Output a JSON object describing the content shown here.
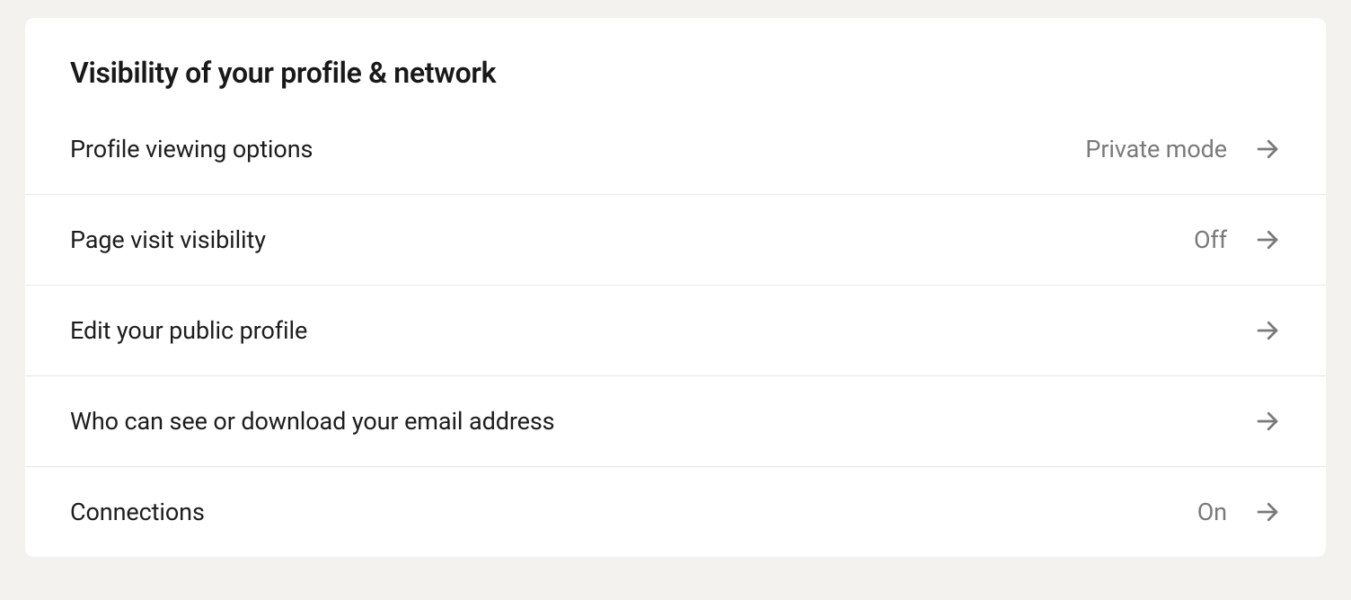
{
  "section": {
    "title": "Visibility of your profile & network"
  },
  "settings": [
    {
      "label": "Profile viewing options",
      "value": "Private mode"
    },
    {
      "label": "Page visit visibility",
      "value": "Off"
    },
    {
      "label": "Edit your public profile",
      "value": ""
    },
    {
      "label": "Who can see or download your email address",
      "value": ""
    },
    {
      "label": "Connections",
      "value": "On"
    }
  ]
}
